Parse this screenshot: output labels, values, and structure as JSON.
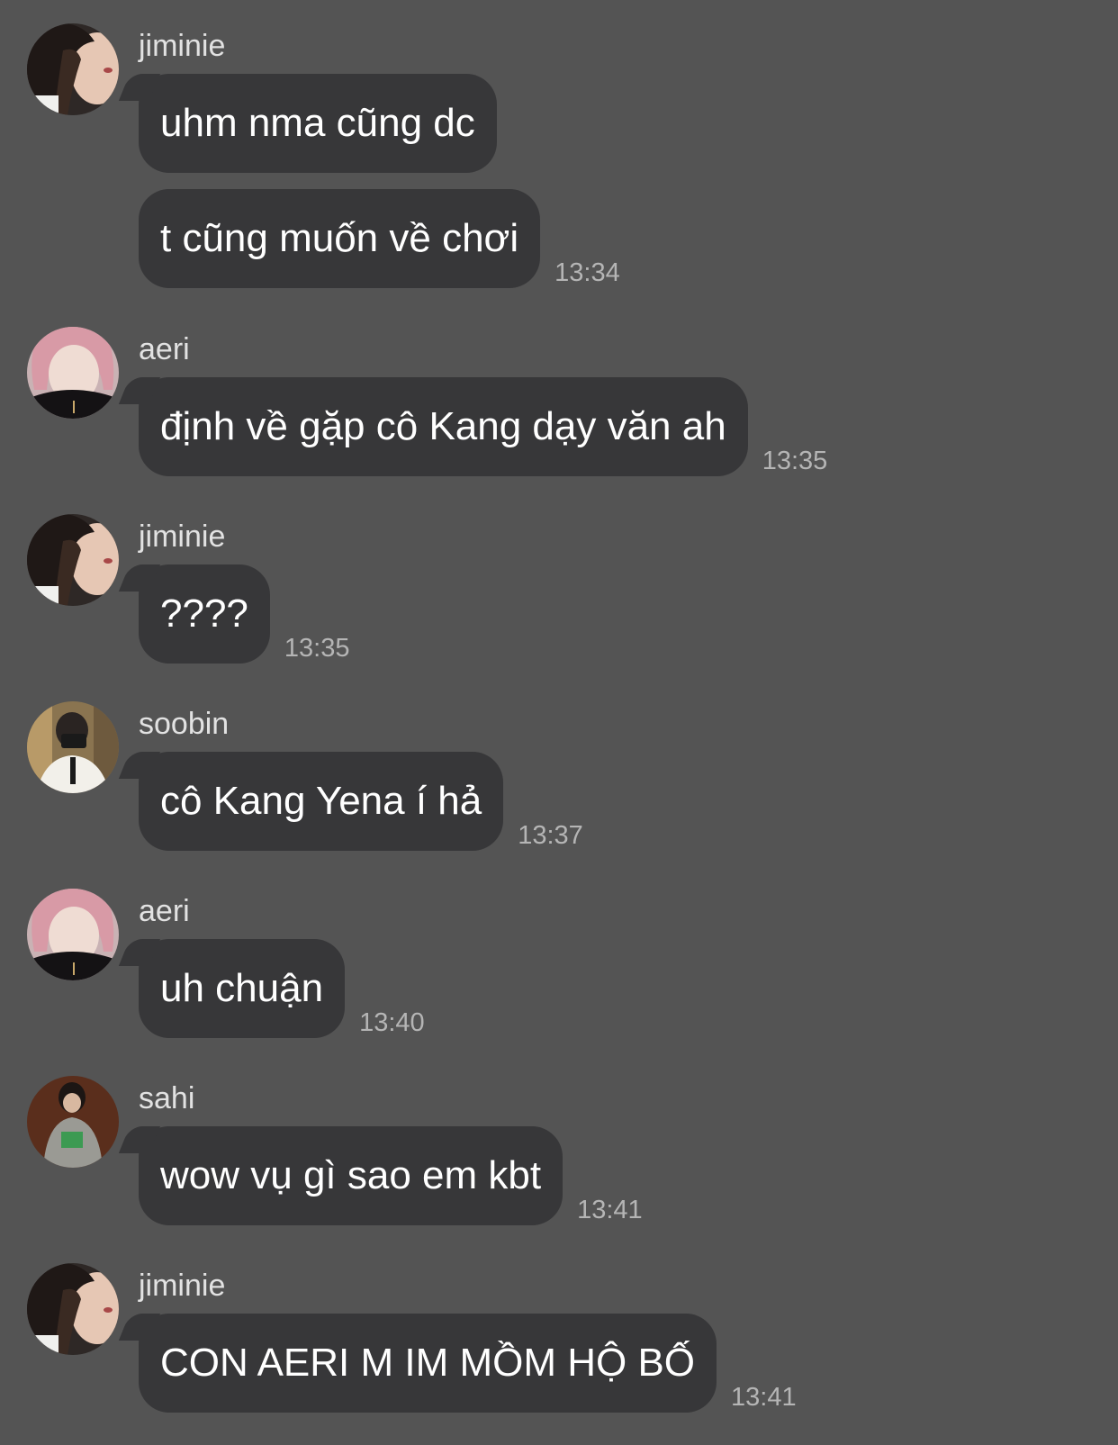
{
  "chat": {
    "groups": [
      {
        "sender": "jiminie",
        "avatar": "jiminie-avatar",
        "messages": [
          {
            "text": "uhm nma cũng dc",
            "time": ""
          },
          {
            "text": "t cũng muốn về chơi ",
            "time": "13:34"
          }
        ]
      },
      {
        "sender": "aeri",
        "avatar": "aeri-avatar",
        "messages": [
          {
            "text": "định về gặp cô Kang dạy văn ah",
            "time": "13:35"
          }
        ]
      },
      {
        "sender": "jiminie",
        "avatar": "jiminie-avatar",
        "messages": [
          {
            "text": "????",
            "time": "13:35"
          }
        ]
      },
      {
        "sender": "soobin",
        "avatar": "soobin-avatar",
        "messages": [
          {
            "text": "cô Kang Yena í hả",
            "time": "13:37"
          }
        ]
      },
      {
        "sender": "aeri",
        "avatar": "aeri-avatar",
        "messages": [
          {
            "text": "uh chuận",
            "time": "13:40"
          }
        ]
      },
      {
        "sender": "sahi",
        "avatar": "sahi-avatar",
        "messages": [
          {
            "text": "wow vụ gì sao em kbt",
            "time": "13:41"
          }
        ]
      },
      {
        "sender": "jiminie",
        "avatar": "jiminie-avatar",
        "messages": [
          {
            "text": "CON AERI M IM MỒM HỘ BỐ",
            "time": "13:41"
          }
        ]
      }
    ]
  },
  "colors": {
    "background": "#545454",
    "bubble": "#373739",
    "bubble_text": "#ffffff",
    "sender_text": "#e2e2e2",
    "time_text": "#b5b5b5"
  }
}
